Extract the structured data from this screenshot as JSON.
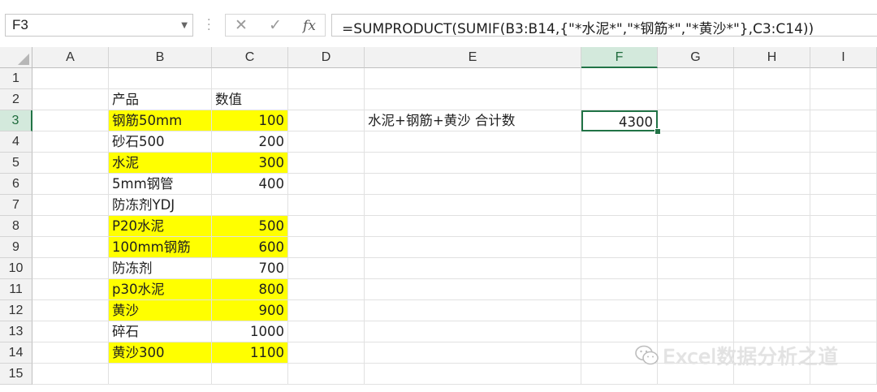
{
  "formula_bar": {
    "name_box": "F3",
    "formula": "=SUMPRODUCT(SUMIF(B3:B14,{\"*水泥*\",\"*钢筋*\",\"*黄沙*\"},C3:C14))",
    "icons": [
      "cancel-x-icon",
      "enter-check-icon",
      "insert-function-fx-icon"
    ]
  },
  "columns": [
    "A",
    "B",
    "C",
    "D",
    "E",
    "F",
    "G",
    "H",
    "I"
  ],
  "selected_column": "F",
  "rows": [
    "1",
    "2",
    "3",
    "4",
    "5",
    "6",
    "7",
    "8",
    "9",
    "10",
    "11",
    "12",
    "13",
    "14",
    "15"
  ],
  "selected_row": "3",
  "table": {
    "header_product": "产品",
    "header_value": "数值",
    "items": [
      {
        "product": "钢筋50mm",
        "value": "100",
        "highlight": true
      },
      {
        "product": "砂石500",
        "value": "200",
        "highlight": false
      },
      {
        "product": "水泥",
        "value": "300",
        "highlight": true
      },
      {
        "product": "5mm钢管",
        "value": "400",
        "highlight": false
      },
      {
        "product": "防冻剂YDJ",
        "value": "",
        "highlight": false
      },
      {
        "product": "P20水泥",
        "value": "500",
        "highlight": true
      },
      {
        "product": "100mm钢筋",
        "value": "600",
        "highlight": true
      },
      {
        "product": "防冻剂",
        "value": "700",
        "highlight": false
      },
      {
        "product": "p30水泥",
        "value": "800",
        "highlight": true
      },
      {
        "product": "黄沙",
        "value": "900",
        "highlight": true
      },
      {
        "product": "碎石",
        "value": "1000",
        "highlight": false
      },
      {
        "product": "黄沙300",
        "value": "1100",
        "highlight": true
      }
    ]
  },
  "result": {
    "label": "水泥+钢筋+黄沙 合计数",
    "value": "4300"
  },
  "watermark": "Excel数据分析之道",
  "colors": {
    "highlight": "#ffff00",
    "selection": "#217346"
  }
}
